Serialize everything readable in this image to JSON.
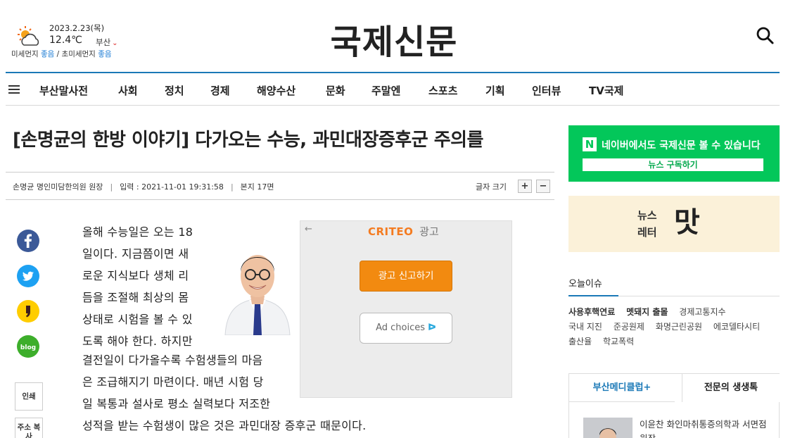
{
  "weather": {
    "date": "2023.2.23(목)",
    "temperature": "12.4℃",
    "region": "부산",
    "dust_label": "미세먼지",
    "dust_value": "좋음",
    "fine_dust_label": "초미세먼지",
    "fine_dust_value": "좋음",
    "icon": "partly-sunny-icon"
  },
  "logo": "국제신문",
  "nav": {
    "items": [
      "부산말사전",
      "사회",
      "정치",
      "경제",
      "해양수산",
      "문화",
      "주말엔",
      "스포츠",
      "기획",
      "인터뷰",
      "TV국제"
    ]
  },
  "article": {
    "headline": "[손명균의 한방 이야기] 다가오는 수능, 과민대장증후군 주의를",
    "author": "손명균 명인미담한의원 원장",
    "published": "입력 : 2021-11-01 19:31:58",
    "edition": "본지 17면",
    "font_size_label": "글자 크기",
    "font_plus": "+",
    "font_minus": "−",
    "lines_narrow": [
      "올해 수능일은 오는 18",
      "일이다. 지금쯤이면 새",
      "로운 지식보다 생체 리",
      "듬을 조절해 최상의 몸",
      "상태로 시험을 볼 수 있",
      "도록 해야 한다. 하지만"
    ],
    "lines_wide": [
      "결전일이 다가올수록 수험생들의 마음",
      "은 조급해지기 마련이다. 매년 시험 당",
      "일 복통과 설사로 평소 실력보다 저조한",
      "성적을 받는 수험생이 많은 것은 과민대장 증후군 때문이다."
    ]
  },
  "share": {
    "print_label": "인쇄",
    "copy_label": "주소 복사"
  },
  "ad": {
    "back": "←",
    "brand": "CRITEO",
    "label": "광고",
    "report_button": "광고 신고하기",
    "choices_button": "Ad choices",
    "choices_icon": "ᐅ"
  },
  "sidebar": {
    "naver_logo": "N",
    "naver_text": "네이버에서도 국제신문 볼 수 있습니다",
    "naver_subscribe": "뉴스 구독하기",
    "newsletter_line1": "뉴스",
    "newsletter_line2": "레터",
    "newsletter_mal": "맛",
    "today_label": "오늘이슈",
    "issues": [
      {
        "text": "사용후핵연료",
        "hot": true
      },
      {
        "text": "멧돼지 출몰",
        "hot": true
      },
      {
        "text": "경제고통지수",
        "hot": false
      },
      {
        "text": "국내 지진",
        "hot": false
      },
      {
        "text": "준공원제",
        "hot": false
      },
      {
        "text": "화명근린공원",
        "hot": false
      },
      {
        "text": "에코델타시티",
        "hot": false
      },
      {
        "text": "출산율",
        "hot": false
      },
      {
        "text": "학교폭력",
        "hot": false
      }
    ],
    "tab_left": "부산메디클럽+",
    "tab_right": "전문의 생생톡",
    "tab_item_text": "이윤찬 화인마취통증의학과 서면점 원장"
  },
  "colors": {
    "accent": "#1b79b7",
    "naver": "#03c75a",
    "criteo": "#f47b20",
    "ad_button": "#f28a10"
  }
}
